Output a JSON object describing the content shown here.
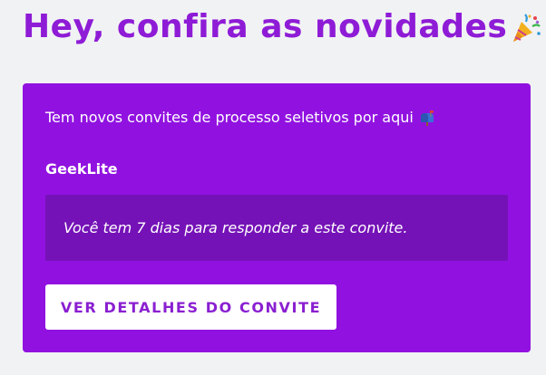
{
  "page": {
    "title": "Hey, confira as novidades",
    "title_emoji": "party-popper-icon"
  },
  "card": {
    "heading": "Tem novos convites de processo seletivos por aqui",
    "heading_emoji": "mailbox-icon",
    "company": "GeekLite",
    "notice": "Você tem 7 dias para responder a este convite.",
    "button_label": "VER DETALHES DO CONVITE"
  },
  "colors": {
    "page_background": "#f1f2f4",
    "title": "#8e1bd6",
    "card_background": "#9112e0",
    "notice_background": "#7512b7",
    "button_background": "#ffffff",
    "button_text": "#8a1fd1",
    "card_text": "#ffffff"
  }
}
